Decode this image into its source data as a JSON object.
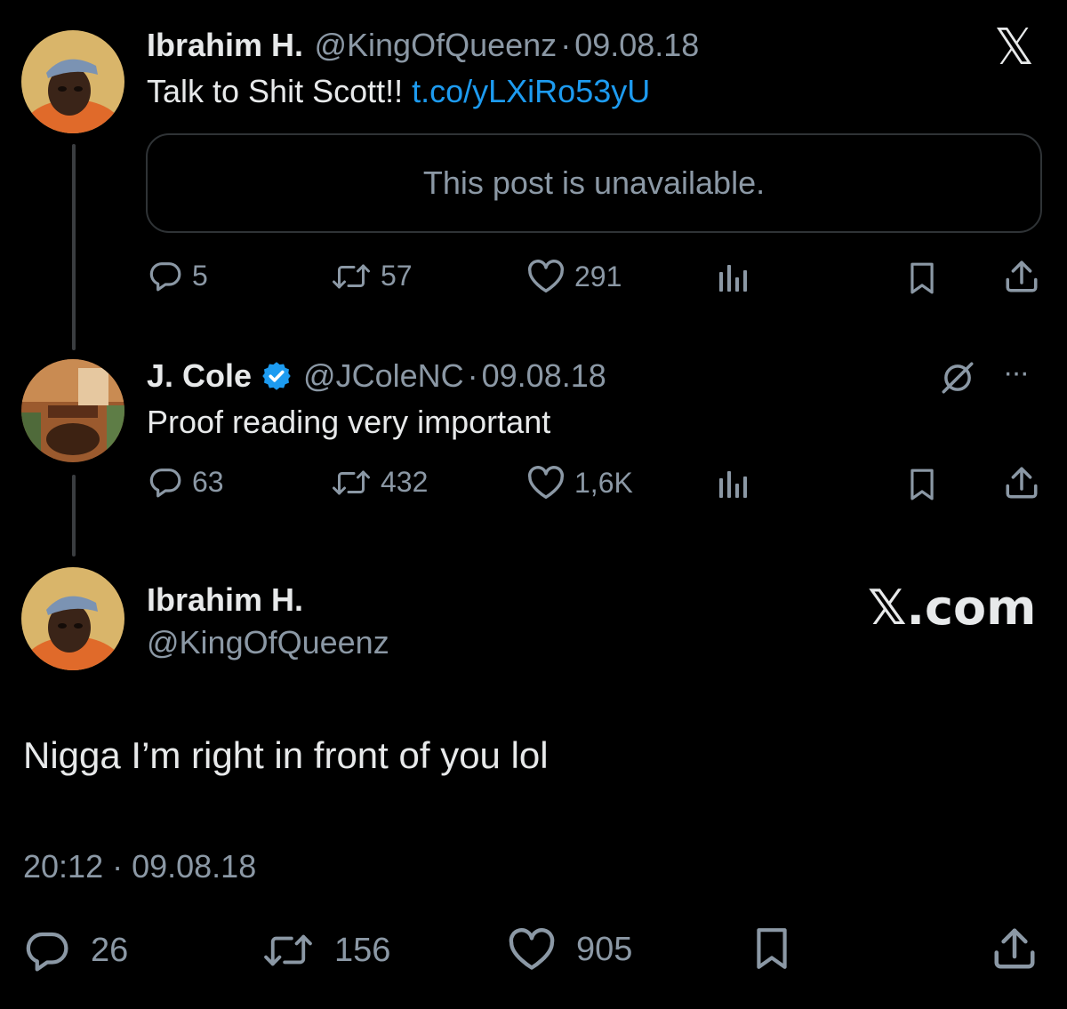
{
  "logo": {
    "text": "𝕏"
  },
  "tweet1": {
    "name": "Ibrahim H.",
    "handle": "@KingOfQueenz",
    "sep": "·",
    "date": "09.08.18",
    "text": "Talk to Shit Scott!! ",
    "link": "t.co/yLXiRo53yU",
    "quote": "This post is unavailable.",
    "replies": "5",
    "reposts": "57",
    "likes": "291"
  },
  "tweet2": {
    "name": "J. Cole",
    "handle": "@JColeNC",
    "sep": "·",
    "date": "09.08.18",
    "text": "Proof reading very important",
    "replies": "63",
    "reposts": "432",
    "likes": "1,6K",
    "more": "···"
  },
  "main": {
    "name": "Ibrahim H.",
    "handle": "@KingOfQueenz",
    "watermark": "𝕏.com",
    "text": "Nigga I’m right in front of you lol",
    "timestamp": "20:12 · 09.08.18",
    "replies": "26",
    "reposts": "156",
    "likes": "905"
  },
  "colors": {
    "background": "#000000",
    "text": "#e7e9ea",
    "muted": "#8b98a5",
    "link": "#1d9bf0",
    "verified": "#1d9bf0"
  },
  "icons": [
    "reply-icon",
    "repost-icon",
    "like-icon",
    "views-icon",
    "bookmark-icon",
    "share-icon",
    "grok-icon",
    "more-icon",
    "verified-badge-icon",
    "x-logo-icon"
  ]
}
